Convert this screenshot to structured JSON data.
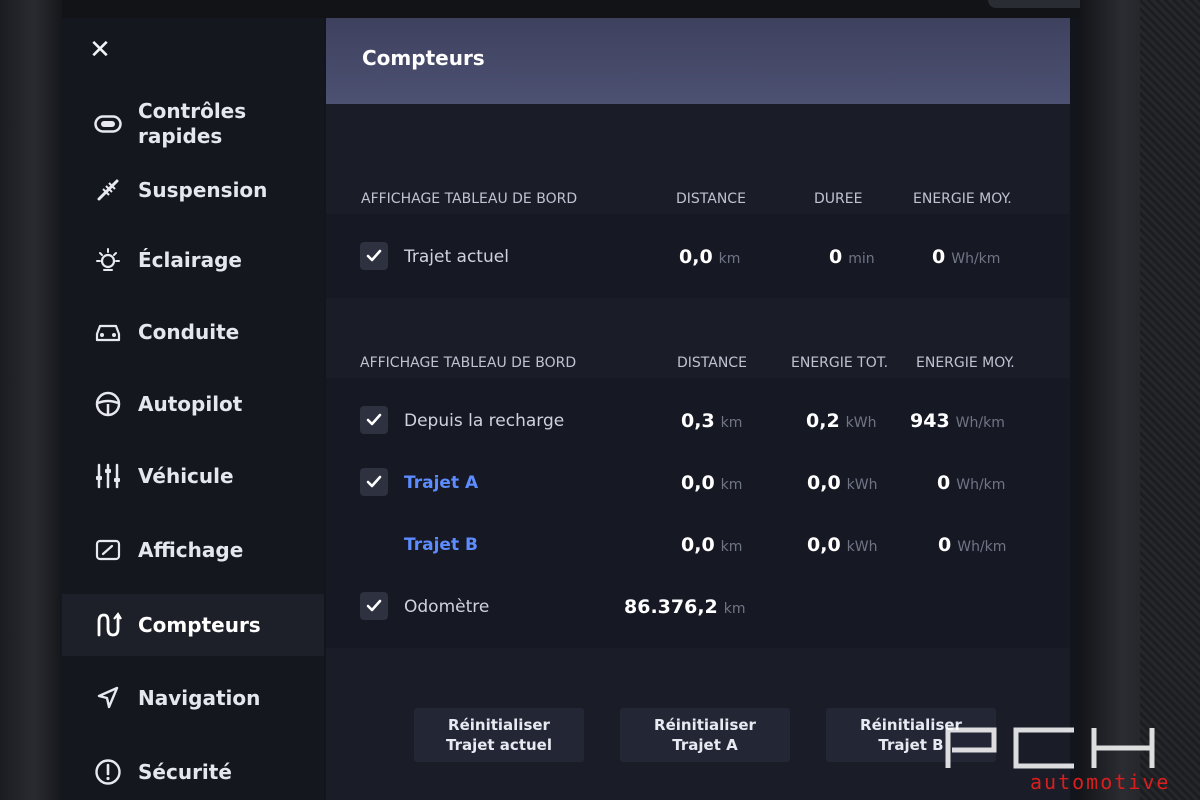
{
  "sidebar": {
    "close_icon": "close-icon",
    "items": [
      {
        "label_line1": "Contrôles",
        "label_line2": "rapides",
        "icon": "toggle-icon"
      },
      {
        "label": "Suspension",
        "icon": "suspension-icon"
      },
      {
        "label": "Éclairage",
        "icon": "light-icon"
      },
      {
        "label": "Conduite",
        "icon": "car-icon"
      },
      {
        "label": "Autopilot",
        "icon": "steering-wheel-icon"
      },
      {
        "label": "Véhicule",
        "icon": "sliders-icon"
      },
      {
        "label": "Affichage",
        "icon": "display-icon"
      },
      {
        "label": "Compteurs",
        "icon": "trip-icon",
        "active": true
      },
      {
        "label": "Navigation",
        "icon": "navigation-arrow-icon"
      },
      {
        "label": "Sécurité",
        "icon": "alert-circle-icon"
      }
    ]
  },
  "main": {
    "title": "Compteurs",
    "section1": {
      "headers": [
        "AFFICHAGE TABLEAU DE BORD",
        "DISTANCE",
        "DUREE",
        "ENERGIE MOY."
      ],
      "rows": [
        {
          "label": "Trajet actuel",
          "checked": true,
          "distance": "0,0",
          "distance_unit": "km",
          "duration": "0",
          "duration_unit": "min",
          "energy": "0",
          "energy_unit": "Wh/km"
        }
      ]
    },
    "section2": {
      "headers": [
        "AFFICHAGE TABLEAU DE BORD",
        "DISTANCE",
        "ENERGIE TOT.",
        "ENERGIE MOY."
      ],
      "rows": [
        {
          "label": "Depuis la recharge",
          "checked": true,
          "distance": "0,3",
          "distance_unit": "km",
          "energy_tot": "0,2",
          "energy_tot_unit": "kWh",
          "energy_avg": "943",
          "energy_avg_unit": "Wh/km"
        },
        {
          "label": "Trajet A",
          "checked": true,
          "distance": "0,0",
          "distance_unit": "km",
          "energy_tot": "0,0",
          "energy_tot_unit": "kWh",
          "energy_avg": "0",
          "energy_avg_unit": "Wh/km"
        },
        {
          "label": "Trajet B",
          "checked": false,
          "distance": "0,0",
          "distance_unit": "km",
          "energy_tot": "0,0",
          "energy_tot_unit": "kWh",
          "energy_avg": "0",
          "energy_avg_unit": "Wh/km"
        },
        {
          "label": "Odomètre",
          "checked": true,
          "distance": "86.376,2",
          "distance_unit": "km"
        }
      ]
    },
    "buttons": [
      {
        "line1": "Réinitialiser",
        "line2": "Trajet actuel"
      },
      {
        "line1": "Réinitialiser",
        "line2": "Trajet A"
      },
      {
        "line1": "Réinitialiser",
        "line2": "Trajet B"
      }
    ]
  },
  "watermark": {
    "logo": "PCH",
    "text": "automotive"
  },
  "colors": {
    "link_blue": "#5c8cff",
    "header_purple": "#4d5172",
    "watermark_red": "#d81e1e"
  }
}
